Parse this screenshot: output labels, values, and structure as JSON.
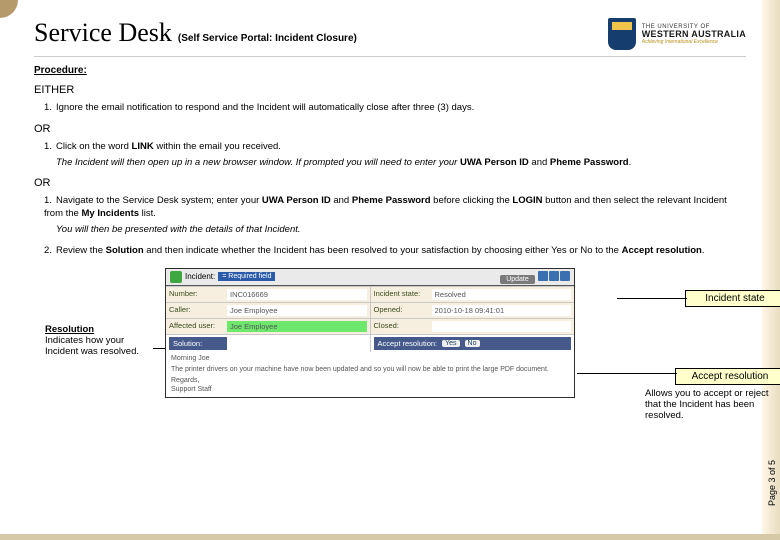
{
  "header": {
    "title": "Service Desk",
    "subtitle": "(Self Service Portal: Incident Closure)",
    "uni_pre": "THE UNIVERSITY OF",
    "uni_main": "WESTERN AUSTRALIA",
    "uni_tag": "Achieving International Excellence"
  },
  "content": {
    "procedure_label": "Procedure:",
    "either": "EITHER",
    "item1": "Ignore the email notification to respond and the Incident will automatically close after three (3) days.",
    "or": "OR",
    "item2a_pre": "Click on the word ",
    "item2a_link": "LINK",
    "item2a_post": " within the email you received.",
    "item2b_pre": "The Incident will then open up in a new browser window.  If prompted you will need to enter your ",
    "item2b_b1": "UWA Person ID",
    "item2b_mid": " and ",
    "item2b_b2": "Pheme Password",
    "item2b_post": ".",
    "item3a_pre": "Navigate to the Service Desk system; enter your ",
    "item3a_b1": "UWA Person ID",
    "item3a_mid": " and ",
    "item3a_b2": "Pheme Password",
    "item3a_mid2": " before clicking the ",
    "item3a_b3": "LOGIN",
    "item3a_mid3": " button and then select the relevant Incident from the ",
    "item3a_b4": "My Incidents",
    "item3a_post": " list.",
    "item3b": "You will then be presented with the details of that Incident.",
    "item4_pre": "Review the ",
    "item4_b1": "Solution",
    "item4_mid": " and then indicate whether the Incident has been resolved to your satisfaction by choosing either ",
    "item4_y": "Yes",
    "item4_or": " or ",
    "item4_n": "No",
    "item4_mid2": " to the ",
    "item4_b2": "Accept resolution",
    "item4_post": "."
  },
  "shot": {
    "incident_lbl": "Incident:",
    "req": "= Required field",
    "update": "Update",
    "row1": {
      "l1": "Number:",
      "v1": "INC016669",
      "l2": "Incident state:",
      "v2": "Resolved"
    },
    "row2": {
      "l1": "Caller:",
      "v1": "Joe Employee",
      "l2": "Opened:",
      "v2": "2010-10-18 09:41:01"
    },
    "row3": {
      "l1": "Affected user:",
      "v1": "Joe Employee",
      "l2": "Closed:",
      "v2": ""
    },
    "row4": {
      "l1": "Solution:",
      "l2": "Accept resolution:",
      "yes": "Yes",
      "no": "No"
    },
    "body_greet": "Morning Joe",
    "body_text": "The printer drivers on your machine have now been updated and so you will now be able to print the large PDF document.",
    "body_reg": "Regards,",
    "body_sig": "Support Staff"
  },
  "callouts": {
    "incident_state": "Incident state",
    "accept_res": "Accept resolution",
    "res_head": "Resolution",
    "res_body": "Indicates how your Incident was resolved.",
    "under": "Allows you to accept or reject that the Incident has been resolved."
  },
  "page": "Page 3 of 5"
}
